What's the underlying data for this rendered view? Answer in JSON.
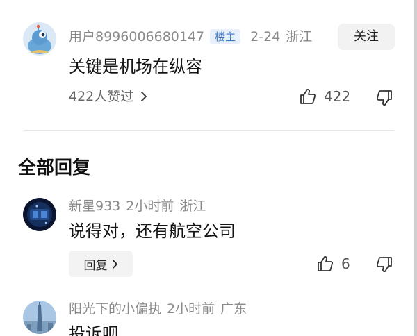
{
  "top_comment": {
    "username": "用户8996006680147",
    "badge": "楼主",
    "date": "2-24",
    "location": "浙江",
    "follow_label": "关注",
    "text": "关键是机场在纵容",
    "likes_link": "422人赞过",
    "like_count": "422",
    "avatar_icon": "blue-robot-avatar"
  },
  "section_title": "全部回复",
  "replies": [
    {
      "username": "新星933",
      "time": "2小时前",
      "location": "浙江",
      "text": "说得对，还有航空公司",
      "reply_label": "回复",
      "like_count": "6",
      "avatar_icon": "dark-blue-avatar"
    },
    {
      "username": "阳光下的小偏执",
      "time": "2小时前",
      "location": "广东",
      "text": "投诉呗",
      "avatar_icon": "tower-avatar"
    }
  ],
  "colors": {
    "meta_gray": "#8a8a8a",
    "badge_bg": "#e7f0fb",
    "badge_text": "#3f76c4",
    "button_bg": "#f2f2f2"
  }
}
